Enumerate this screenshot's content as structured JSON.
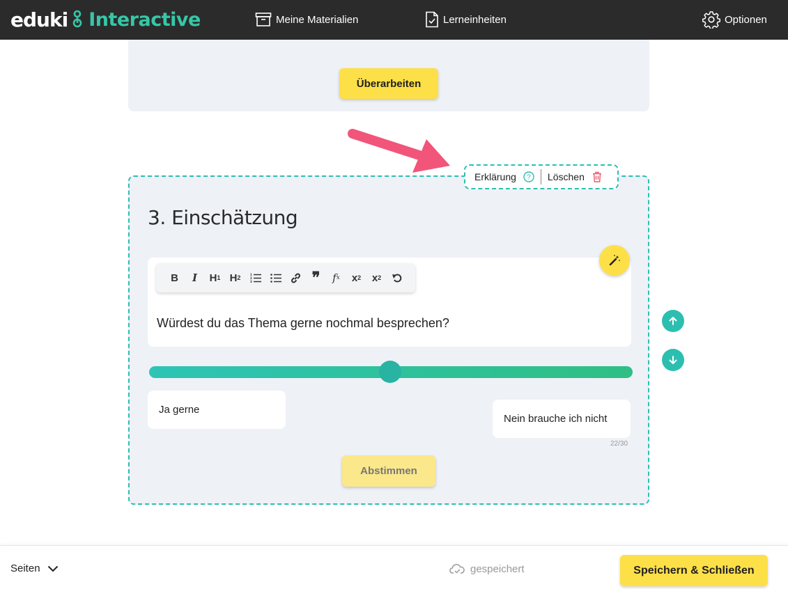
{
  "header": {
    "logo_eduki": "eduki",
    "logo_interactive": "Interactive",
    "nav": {
      "materialien": "Meine Materialien",
      "lerneinheiten": "Lerneinheiten",
      "optionen": "Optionen"
    }
  },
  "previous_card": {
    "button_label": "Überarbeiten"
  },
  "block": {
    "tabs": {
      "erklaerung": "Erklärung",
      "loeschen": "Löschen"
    },
    "title": "3. Einschätzung",
    "toolbar": [
      "bold-icon",
      "italic-icon",
      "heading1-icon",
      "heading2-icon",
      "ordered-list-icon",
      "bullet-list-icon",
      "link-icon",
      "quote-icon",
      "formula-icon",
      "subscript-icon",
      "superscript-icon",
      "undo-icon"
    ],
    "question": "Würdest du das Thema gerne nochmal besprechen?",
    "slider_value": 0.5,
    "label_left": "Ja gerne",
    "label_right": "Nein brauche ich nicht",
    "char_counter": "22/30",
    "vote_button": "Abstimmen"
  },
  "colors": {
    "accent": "#2cbfb0",
    "yellow": "#fde047",
    "topbar": "#2b2b2b",
    "card": "#eef1f6",
    "arrow": "#f2557a",
    "delete": "#e85a6e"
  },
  "footer": {
    "pages": "Seiten",
    "status": "gespeichert",
    "save_button": "Speichern & Schließen"
  }
}
